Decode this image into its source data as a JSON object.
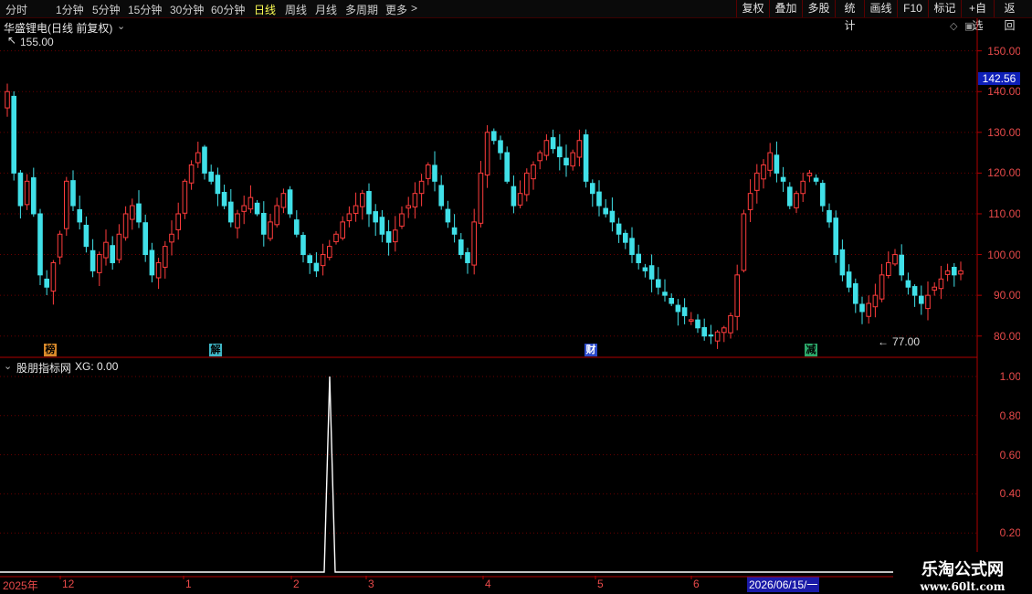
{
  "toolbar": {
    "periods": [
      "分时",
      "1分钟",
      "5分钟",
      "15分钟",
      "30分钟",
      "60分钟",
      "日线",
      "周线",
      "月线",
      "多周期",
      "更多"
    ],
    "active_period": "日线",
    "more_chevron": ">",
    "right_buttons": [
      "复权",
      "叠加",
      "多股",
      "统计",
      "画线",
      "F10",
      "标记",
      "+自选",
      "返回"
    ]
  },
  "main_panel": {
    "title": "华盛锂电(日线 前复权)",
    "price_ticks": [
      "150.00",
      "140.00",
      "130.00",
      "120.00",
      "110.00",
      "100.00",
      "90.00",
      "80.00"
    ],
    "current_price": "142.56",
    "high_label": "155.00",
    "low_label": "77.00",
    "events": [
      "榜",
      "解",
      "财",
      "减"
    ]
  },
  "indicator_panel": {
    "title": "股朋指标网",
    "value_text": "XG: 0.00",
    "ticks": [
      "1.00",
      "0.80",
      "0.60",
      "0.40",
      "0.20"
    ]
  },
  "date_axis": {
    "labels": [
      "2025年",
      "12",
      "1",
      "2",
      "3",
      "4",
      "5",
      "6"
    ],
    "cursor_date": "2026/06/15/一"
  },
  "watermark": {
    "line1": "乐淘公式网",
    "line2": "www.60lt.com"
  },
  "chart_data": {
    "type": "candlestick",
    "title": "华盛锂电(日线 前复权)",
    "ylim": [
      75,
      158
    ],
    "close": [
      140,
      120,
      112,
      118,
      110,
      95,
      92,
      98,
      105,
      118,
      112,
      108,
      102,
      96,
      100,
      103,
      98,
      105,
      110,
      112,
      108,
      100,
      95,
      98,
      102,
      105,
      110,
      118,
      122,
      125,
      120,
      118,
      115,
      112,
      108,
      110,
      112,
      114,
      110,
      105,
      108,
      112,
      115,
      110,
      105,
      100,
      98,
      96,
      100,
      102,
      105,
      108,
      110,
      112,
      115,
      110,
      108,
      105,
      103,
      106,
      110,
      112,
      115,
      118,
      122,
      118,
      112,
      108,
      105,
      100,
      98,
      108,
      120,
      130,
      128,
      125,
      118,
      112,
      115,
      120,
      122,
      125,
      128,
      126,
      124,
      122,
      125,
      128,
      118,
      115,
      112,
      110,
      108,
      105,
      103,
      100,
      98,
      96,
      94,
      92,
      90,
      88,
      86,
      85,
      84,
      82,
      80,
      80,
      81,
      82,
      85,
      95,
      110,
      115,
      120,
      122,
      125,
      120,
      118,
      112,
      115,
      118,
      120,
      118,
      112,
      108,
      100,
      95,
      92,
      88,
      86,
      88,
      90,
      95,
      98,
      100,
      95,
      92,
      90,
      88,
      90,
      92,
      94,
      96,
      95,
      96
    ],
    "xg_spike_date": "2026-02-20",
    "xg_spike_value": 1.0
  }
}
